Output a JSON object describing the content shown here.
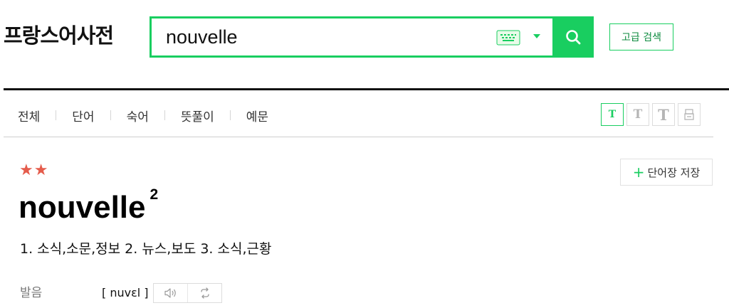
{
  "header": {
    "logo": "프랑스어사전",
    "search_value": "nouvelle",
    "advanced_label": "고급 검색"
  },
  "tabs": [
    {
      "label": "전체"
    },
    {
      "label": "단어"
    },
    {
      "label": "숙어"
    },
    {
      "label": "뜻풀이"
    },
    {
      "label": "예문"
    }
  ],
  "font_controls": {
    "buttons": [
      {
        "glyph": "T",
        "icon": "font-size-small-icon",
        "active": true
      },
      {
        "glyph": "T",
        "icon": "font-size-medium-icon",
        "active": false
      },
      {
        "glyph": "T",
        "icon": "font-size-large-icon",
        "active": false
      }
    ],
    "print_icon": "print-icon"
  },
  "entry": {
    "stars": "★★",
    "save_label": "단어장 저장",
    "headword": "nouvelle",
    "superscript": "2",
    "meanings": "1. 소식,소문,정보 2. 뉴스,보도 3. 소식,근황",
    "pron_label": "발음",
    "pron_ipa": "[ nuvɛl ]"
  },
  "colors": {
    "accent": "#19ce60",
    "stars": "#e55c4c"
  }
}
